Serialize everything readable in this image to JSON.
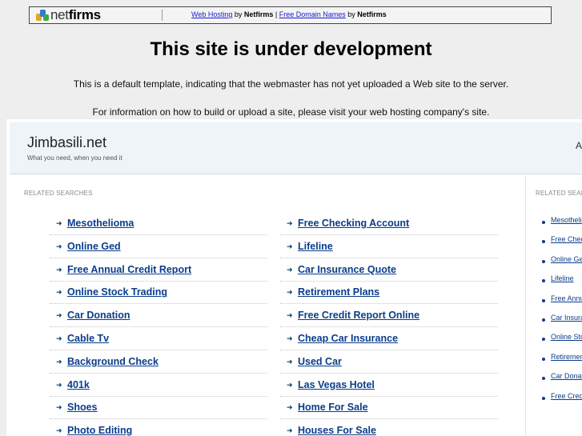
{
  "topbar": {
    "logo_net": "net",
    "logo_firms": "firms",
    "link_web_hosting": "Web Hosting",
    "by1": " by ",
    "brand1": "Netfirms",
    "divider": " | ",
    "link_domain_names": "Free Domain Names",
    "by2": " by ",
    "brand2": "Netfirms",
    "colors": {
      "link": "#1a1acc",
      "border": "#444444"
    }
  },
  "notice": {
    "title": "This site is under development",
    "line1": "This is a default template, indicating that the webmaster has not yet uploaded a Web site to the server.",
    "line2": "For information on how to build or upload a site, please visit your web hosting company's site."
  },
  "parked": {
    "site_name": "Jimbasili.net",
    "tagline": "What you need, when you need it",
    "header_edge_char": "A",
    "main_label": "RELATED SEARCHES",
    "side_label": "RELATED SEARCHES",
    "left_links": [
      "Mesothelioma",
      "Online Ged",
      "Free Annual Credit Report",
      "Online Stock Trading",
      "Car Donation",
      "Cable Tv",
      "Background Check",
      "401k",
      "Shoes",
      "Photo Editing"
    ],
    "right_links": [
      "Free Checking Account",
      "Lifeline",
      "Car Insurance Quote",
      "Retirement Plans",
      "Free Credit Report Online",
      "Cheap Car Insurance",
      "Used Car",
      "Las Vegas Hotel",
      "Home For Sale",
      "Houses For Sale"
    ],
    "side_links": [
      "Mesothelioma",
      "Free Checking Account",
      "Online Ged",
      "Lifeline",
      "Free Annual Credit Report",
      "Car Insurance Quote",
      "Online Stock Trading",
      "Retirement Plans",
      "Car Donation",
      "Free Credit Report Online"
    ],
    "colors": {
      "header_bg": "#eef4f8",
      "link": "#0a3d8a"
    }
  }
}
